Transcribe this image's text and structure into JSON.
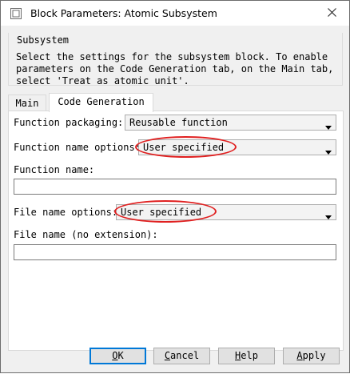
{
  "window": {
    "title": "Block Parameters: Atomic Subsystem"
  },
  "group": {
    "title": "Subsystem",
    "description": "Select the settings for the subsystem block. To enable\nparameters on the Code Generation tab, on the Main tab,\nselect 'Treat as atomic unit'."
  },
  "tabs": [
    {
      "label": "Main",
      "selected": false
    },
    {
      "label": "Code Generation",
      "selected": true
    }
  ],
  "code_generation": {
    "function_packaging": {
      "label": "Function packaging:",
      "value": "Reusable function"
    },
    "function_name_options": {
      "label": "Function name options:",
      "value": "User specified",
      "highlighted": true
    },
    "function_name": {
      "label": "Function name:",
      "value": ""
    },
    "file_name_options": {
      "label": "File name options:",
      "value": "User specified",
      "highlighted": true
    },
    "file_name": {
      "label": "File name (no extension):",
      "value": ""
    }
  },
  "buttons": {
    "ok": {
      "mnemonic": "O",
      "rest": "K"
    },
    "cancel": {
      "mnemonic": "C",
      "rest": "ancel"
    },
    "help": {
      "mnemonic": "H",
      "rest": "elp"
    },
    "apply": {
      "mnemonic": "A",
      "rest": "pply"
    }
  },
  "colors": {
    "highlight_ring": "#e02020",
    "default_button_border": "#0078d7"
  },
  "icons": {
    "app": "simulink-block-icon",
    "close": "close-icon",
    "dropdown": "chevron-down-icon"
  }
}
